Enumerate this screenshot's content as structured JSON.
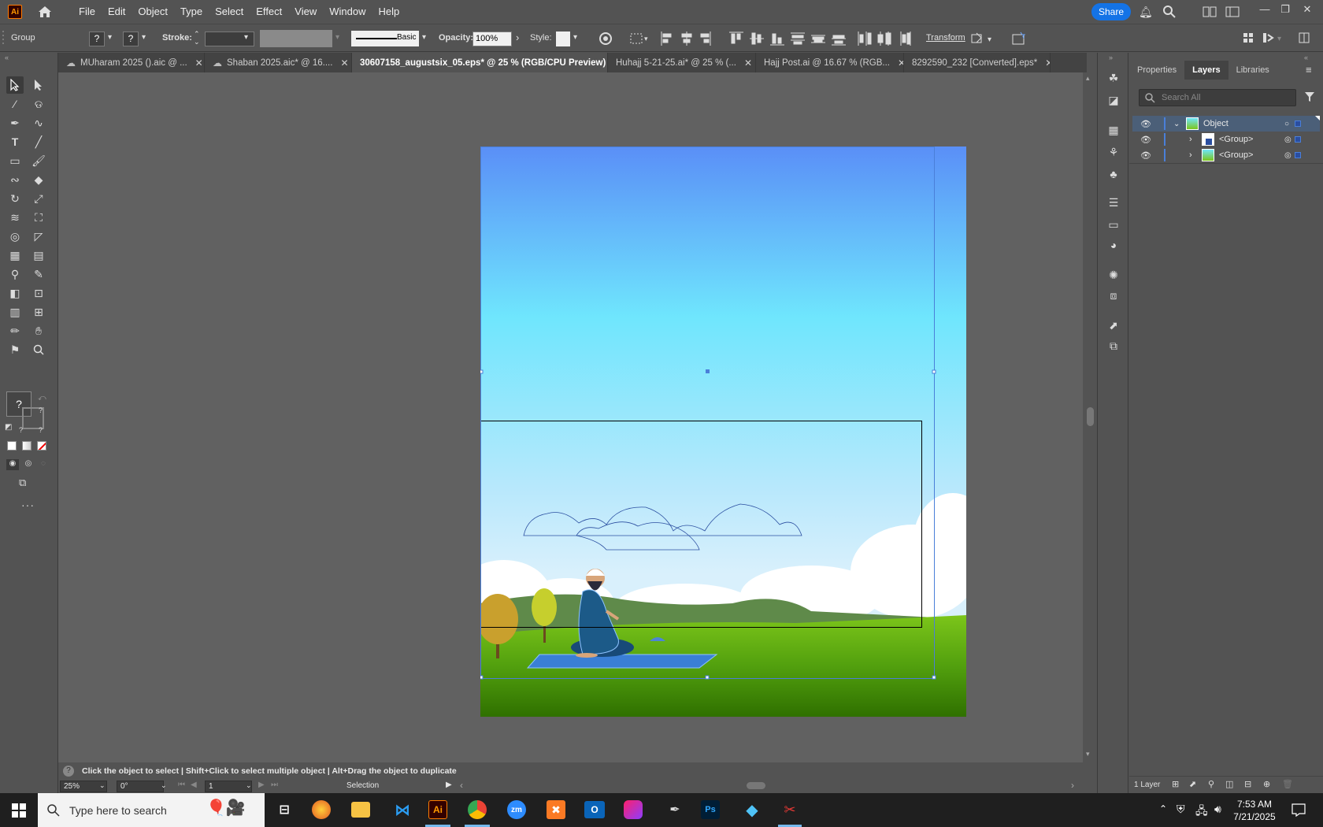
{
  "app": {
    "logo": "Ai",
    "menu": [
      "File",
      "Edit",
      "Object",
      "Type",
      "Select",
      "Effect",
      "View",
      "Window",
      "Help"
    ],
    "share": "Share"
  },
  "control": {
    "selection_type": "Group",
    "stroke_label": "Stroke:",
    "stroke_style": "Basic",
    "opacity_label": "Opacity:",
    "opacity_value": "100%",
    "style_label": "Style:",
    "transform_label": "Transform",
    "question_mark": "?"
  },
  "tabs": [
    {
      "label": "MUharam 2025 ().aic @ ...",
      "cloud": true,
      "active": false
    },
    {
      "label": "Shaban 2025.aic* @ 16....",
      "cloud": true,
      "active": false
    },
    {
      "label": "30607158_augustsix_05.eps* @ 25 % (RGB/CPU Preview)",
      "cloud": false,
      "active": true
    },
    {
      "label": "Huhajj 5-21-25.ai* @ 25 % (...",
      "cloud": false,
      "active": false
    },
    {
      "label": "Hajj Post.ai @ 16.67 % (RGB...",
      "cloud": false,
      "active": false
    },
    {
      "label": "8292590_232 [Converted].eps*",
      "cloud": false,
      "active": false
    }
  ],
  "panel": {
    "tabs": [
      "Properties",
      "Layers",
      "Libraries"
    ],
    "active_tab": "Layers",
    "search_placeholder": "Search All",
    "layers": [
      {
        "name": "Object",
        "level": 0,
        "expanded": true
      },
      {
        "name": "<Group>",
        "level": 1,
        "expanded": false
      },
      {
        "name": "<Group>",
        "level": 1,
        "expanded": false
      }
    ],
    "layer_count": "1 Layer"
  },
  "status": {
    "hint": "Click the object to select  |  Shift+Click to select multiple object  |  Alt+Drag the object to duplicate",
    "zoom": "25%",
    "rotation": "0°",
    "artboard_num": "1",
    "tool": "Selection"
  },
  "taskbar": {
    "search_placeholder": "Type here to search",
    "time": "7:53 AM",
    "date": "7/21/2025"
  },
  "colors": {
    "accent": "#1473e6",
    "selection": "#4a7fd9",
    "ui_bg": "#535353",
    "canvas_bg": "#616161"
  }
}
